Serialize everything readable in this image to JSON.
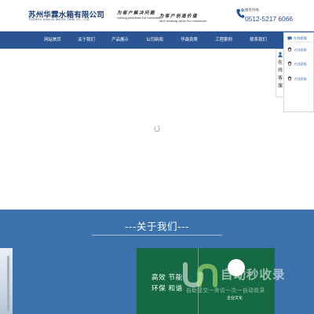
{
  "header": {
    "company_name_cn": "苏州华霖水箱有限公司",
    "company_name_en": "SUZHOU HUALIN WATER TANK CO., LTD",
    "slogans": [
      {
        "cn": "为客户解决问题",
        "en": "solving problems for customers"
      },
      {
        "cn": "为客户创造价值",
        "en": "and creating value for customers"
      }
    ],
    "hotline_label": "服务热线:",
    "phone": "0512-5217 6066"
  },
  "nav": {
    "items": [
      "网站首页",
      "关于我们",
      "产品展示",
      "公司新闻",
      "华霖资质",
      "工程案例",
      "联系我们"
    ]
  },
  "side_service": {
    "tab_text": [
      "在",
      "线",
      "客",
      "服"
    ],
    "header": "在线客服",
    "items": [
      "在线客服",
      "在线客服",
      "在线客服"
    ]
  },
  "about": {
    "title": "---关于我们---",
    "features_line1": "高效 节能",
    "features_line2": "环保 和谐",
    "culture_label": "企业文化"
  },
  "watermark": {
    "title": "自动秒收录",
    "subtitle": "自助提交一来访一次一自动收录"
  },
  "colors": {
    "nav_bg": "#2b5592",
    "about_bg": "#3c72ab",
    "green_panel": "#166a43",
    "phone_text": "#1e4f96"
  },
  "icons": [
    "phone-icon",
    "loading-spinner-icon",
    "user-icon",
    "chat-icon",
    "qq-icon"
  ]
}
